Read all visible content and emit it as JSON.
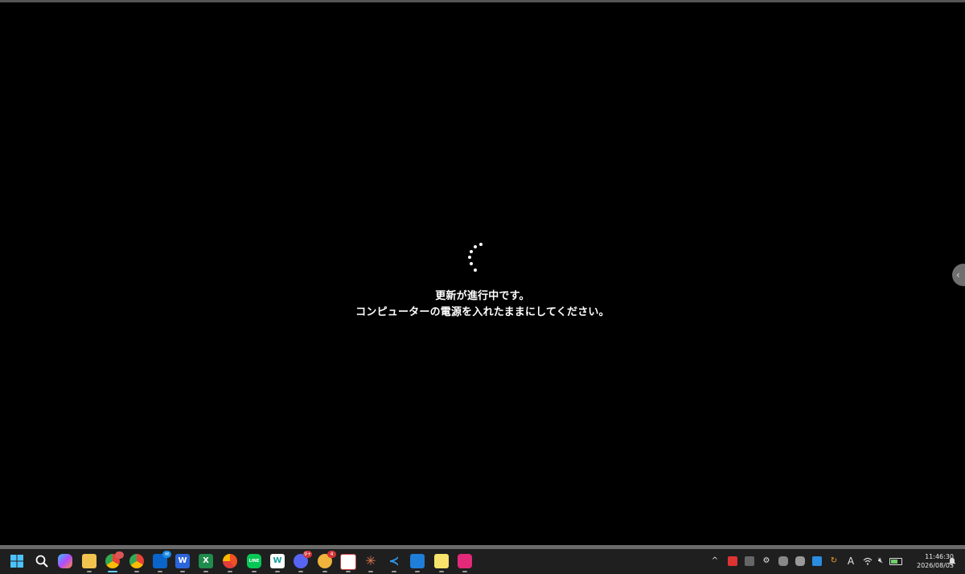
{
  "update": {
    "line1": "更新が進行中です。",
    "line2": "コンピューターの電源を入れたままにしてください。"
  },
  "taskbar": {
    "start_icon": "windows-start-icon",
    "apps": [
      {
        "name": "search-icon"
      },
      {
        "name": "copilot-icon"
      },
      {
        "name": "file-explorer-icon"
      },
      {
        "name": "chrome-icon"
      },
      {
        "name": "chrome-profile-icon"
      },
      {
        "name": "outlook-icon"
      },
      {
        "name": "word-icon",
        "glyph": "W"
      },
      {
        "name": "excel-icon",
        "glyph": "X"
      },
      {
        "name": "pie-app-icon"
      },
      {
        "name": "line-icon",
        "glyph": "LINE"
      },
      {
        "name": "writing-app-icon",
        "glyph": "W"
      },
      {
        "name": "discord-icon",
        "badge": "9+"
      },
      {
        "name": "chat-app-icon",
        "badge": "4"
      },
      {
        "name": "snipping-tool-icon"
      },
      {
        "name": "claude-icon"
      },
      {
        "name": "vscode-icon"
      },
      {
        "name": "photos-icon"
      },
      {
        "name": "sticky-notes-icon"
      },
      {
        "name": "pink-app-icon"
      }
    ],
    "tray": {
      "chevron": "^",
      "ime": "A",
      "time": "11:46:30",
      "date": "2026/08/05"
    }
  },
  "colors": {
    "screen_background": "#000000",
    "taskbar_background": "#1f1f1f",
    "accent": "#60cdff"
  }
}
